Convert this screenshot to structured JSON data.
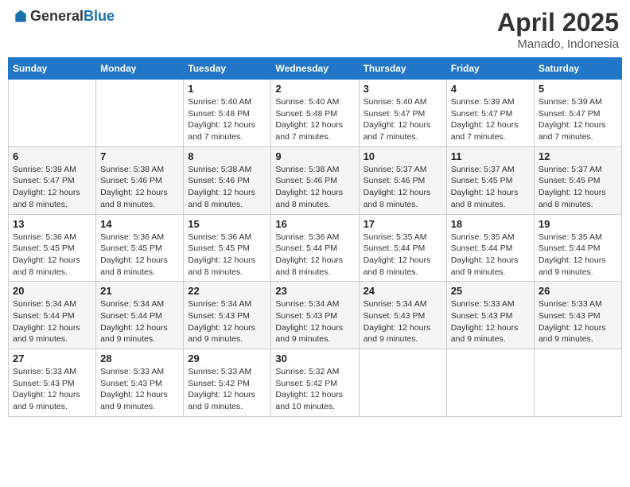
{
  "logo": {
    "general": "General",
    "blue": "Blue"
  },
  "title": "April 2025",
  "location": "Manado, Indonesia",
  "weekdays": [
    "Sunday",
    "Monday",
    "Tuesday",
    "Wednesday",
    "Thursday",
    "Friday",
    "Saturday"
  ],
  "weeks": [
    [
      {
        "day": "",
        "info": ""
      },
      {
        "day": "",
        "info": ""
      },
      {
        "day": "1",
        "info": "Sunrise: 5:40 AM\nSunset: 5:48 PM\nDaylight: 12 hours and 7 minutes."
      },
      {
        "day": "2",
        "info": "Sunrise: 5:40 AM\nSunset: 5:48 PM\nDaylight: 12 hours and 7 minutes."
      },
      {
        "day": "3",
        "info": "Sunrise: 5:40 AM\nSunset: 5:47 PM\nDaylight: 12 hours and 7 minutes."
      },
      {
        "day": "4",
        "info": "Sunrise: 5:39 AM\nSunset: 5:47 PM\nDaylight: 12 hours and 7 minutes."
      },
      {
        "day": "5",
        "info": "Sunrise: 5:39 AM\nSunset: 5:47 PM\nDaylight: 12 hours and 7 minutes."
      }
    ],
    [
      {
        "day": "6",
        "info": "Sunrise: 5:39 AM\nSunset: 5:47 PM\nDaylight: 12 hours and 8 minutes."
      },
      {
        "day": "7",
        "info": "Sunrise: 5:38 AM\nSunset: 5:46 PM\nDaylight: 12 hours and 8 minutes."
      },
      {
        "day": "8",
        "info": "Sunrise: 5:38 AM\nSunset: 5:46 PM\nDaylight: 12 hours and 8 minutes."
      },
      {
        "day": "9",
        "info": "Sunrise: 5:38 AM\nSunset: 5:46 PM\nDaylight: 12 hours and 8 minutes."
      },
      {
        "day": "10",
        "info": "Sunrise: 5:37 AM\nSunset: 5:46 PM\nDaylight: 12 hours and 8 minutes."
      },
      {
        "day": "11",
        "info": "Sunrise: 5:37 AM\nSunset: 5:45 PM\nDaylight: 12 hours and 8 minutes."
      },
      {
        "day": "12",
        "info": "Sunrise: 5:37 AM\nSunset: 5:45 PM\nDaylight: 12 hours and 8 minutes."
      }
    ],
    [
      {
        "day": "13",
        "info": "Sunrise: 5:36 AM\nSunset: 5:45 PM\nDaylight: 12 hours and 8 minutes."
      },
      {
        "day": "14",
        "info": "Sunrise: 5:36 AM\nSunset: 5:45 PM\nDaylight: 12 hours and 8 minutes."
      },
      {
        "day": "15",
        "info": "Sunrise: 5:36 AM\nSunset: 5:45 PM\nDaylight: 12 hours and 8 minutes."
      },
      {
        "day": "16",
        "info": "Sunrise: 5:36 AM\nSunset: 5:44 PM\nDaylight: 12 hours and 8 minutes."
      },
      {
        "day": "17",
        "info": "Sunrise: 5:35 AM\nSunset: 5:44 PM\nDaylight: 12 hours and 8 minutes."
      },
      {
        "day": "18",
        "info": "Sunrise: 5:35 AM\nSunset: 5:44 PM\nDaylight: 12 hours and 9 minutes."
      },
      {
        "day": "19",
        "info": "Sunrise: 5:35 AM\nSunset: 5:44 PM\nDaylight: 12 hours and 9 minutes."
      }
    ],
    [
      {
        "day": "20",
        "info": "Sunrise: 5:34 AM\nSunset: 5:44 PM\nDaylight: 12 hours and 9 minutes."
      },
      {
        "day": "21",
        "info": "Sunrise: 5:34 AM\nSunset: 5:44 PM\nDaylight: 12 hours and 9 minutes."
      },
      {
        "day": "22",
        "info": "Sunrise: 5:34 AM\nSunset: 5:43 PM\nDaylight: 12 hours and 9 minutes."
      },
      {
        "day": "23",
        "info": "Sunrise: 5:34 AM\nSunset: 5:43 PM\nDaylight: 12 hours and 9 minutes."
      },
      {
        "day": "24",
        "info": "Sunrise: 5:34 AM\nSunset: 5:43 PM\nDaylight: 12 hours and 9 minutes."
      },
      {
        "day": "25",
        "info": "Sunrise: 5:33 AM\nSunset: 5:43 PM\nDaylight: 12 hours and 9 minutes."
      },
      {
        "day": "26",
        "info": "Sunrise: 5:33 AM\nSunset: 5:43 PM\nDaylight: 12 hours and 9 minutes."
      }
    ],
    [
      {
        "day": "27",
        "info": "Sunrise: 5:33 AM\nSunset: 5:43 PM\nDaylight: 12 hours and 9 minutes."
      },
      {
        "day": "28",
        "info": "Sunrise: 5:33 AM\nSunset: 5:43 PM\nDaylight: 12 hours and 9 minutes."
      },
      {
        "day": "29",
        "info": "Sunrise: 5:33 AM\nSunset: 5:42 PM\nDaylight: 12 hours and 9 minutes."
      },
      {
        "day": "30",
        "info": "Sunrise: 5:32 AM\nSunset: 5:42 PM\nDaylight: 12 hours and 10 minutes."
      },
      {
        "day": "",
        "info": ""
      },
      {
        "day": "",
        "info": ""
      },
      {
        "day": "",
        "info": ""
      }
    ]
  ]
}
